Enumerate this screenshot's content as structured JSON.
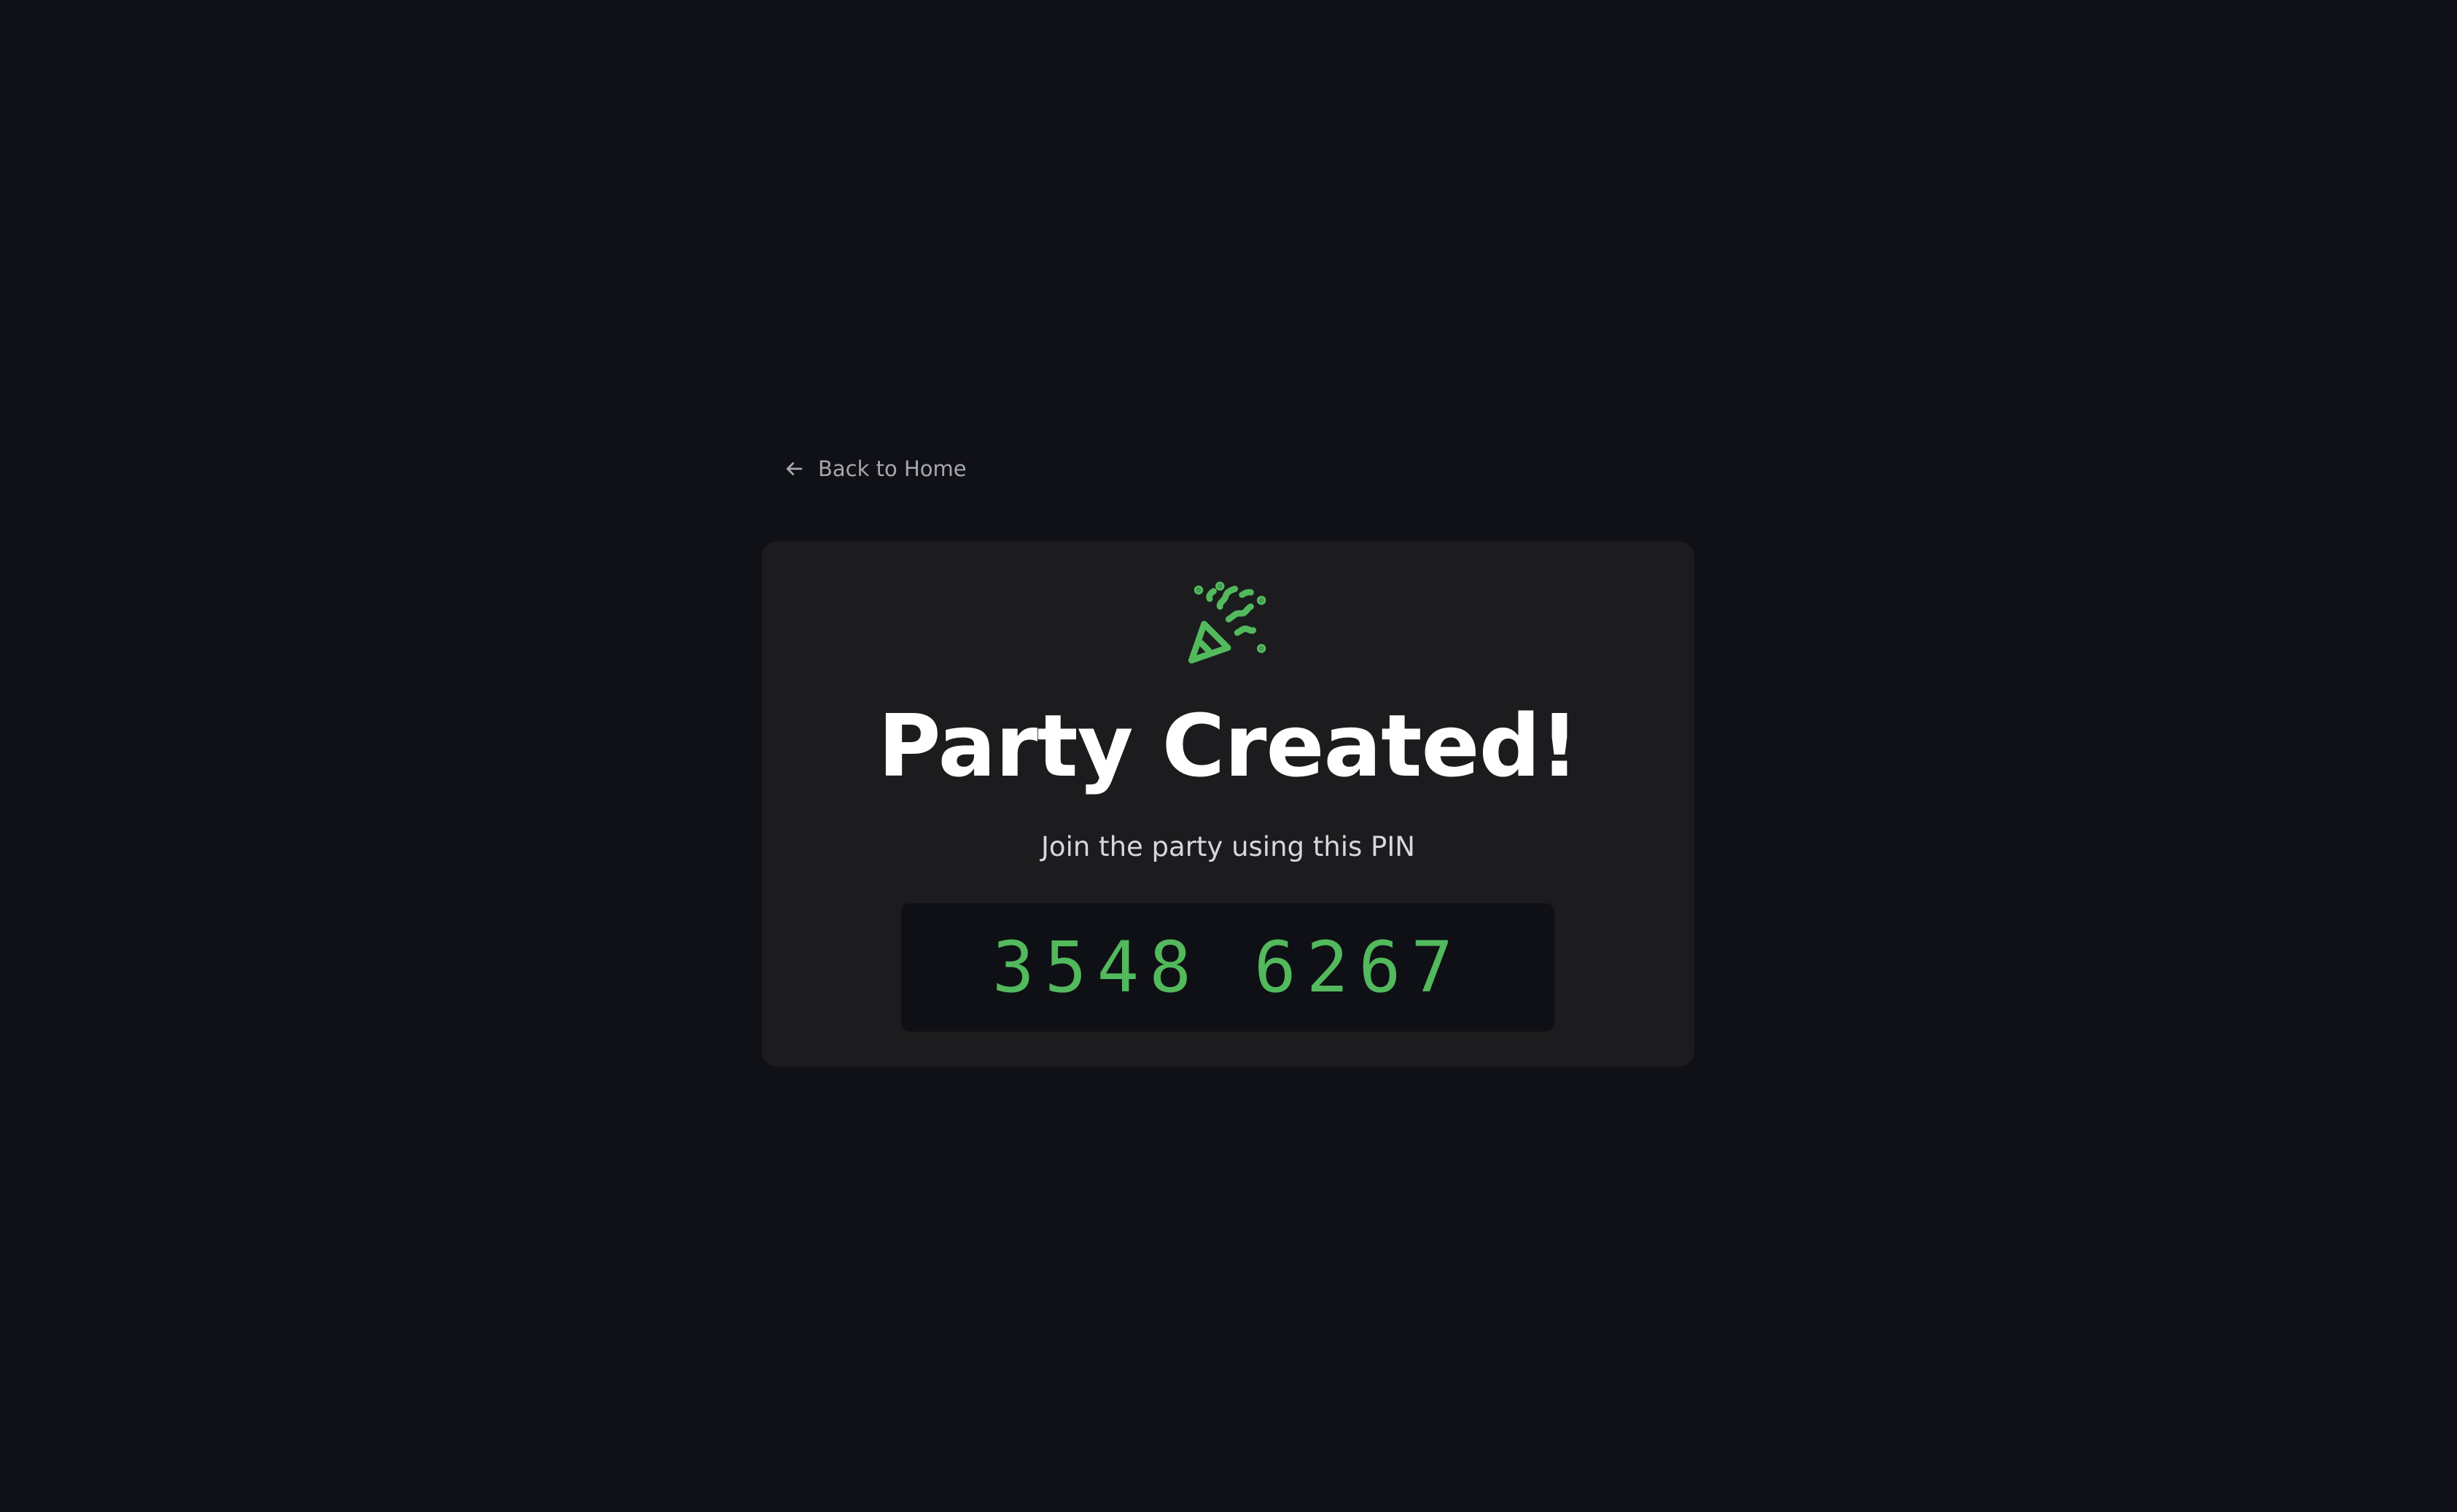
{
  "nav": {
    "back_label": "Back to Home",
    "back_icon": "arrow-left-icon"
  },
  "card": {
    "icon": "party-popper-icon",
    "title": "Party Created!",
    "subtitle": "Join the party using this PIN",
    "pin": "3548 6267"
  },
  "colors": {
    "background": "#101116",
    "card_background": "#1c1c1e",
    "pin_background": "#0f1015",
    "accent": "#52b95d",
    "title_text": "#ffffff",
    "muted_text": "#a6a7ad"
  }
}
